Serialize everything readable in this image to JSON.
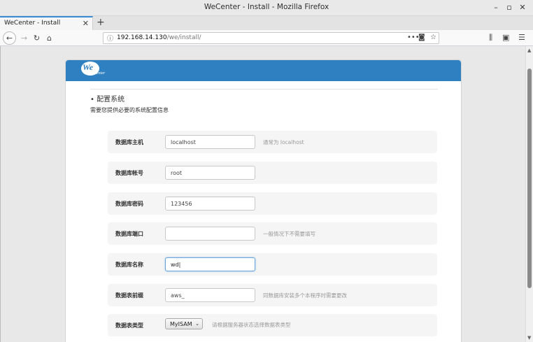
{
  "window": {
    "title": "WeCenter - Install - Mozilla Firefox"
  },
  "tab": {
    "label": "WeCenter - Install"
  },
  "url": {
    "host": "192.168.14.130",
    "path": "/we/install/"
  },
  "logo": {
    "we": "We",
    "center": "Center"
  },
  "section": {
    "title": "• 配置系统",
    "desc": "需要您提供必要的系统配置信息"
  },
  "fields": [
    {
      "label": "数据库主机",
      "value": "localhost",
      "hint": "通常为 localhost"
    },
    {
      "label": "数据库帐号",
      "value": "root",
      "hint": ""
    },
    {
      "label": "数据库密码",
      "value": "123456",
      "hint": ""
    },
    {
      "label": "数据库端口",
      "value": "",
      "hint": "一般情况下不需要填写"
    },
    {
      "label": "数据库名称",
      "value": "wd|",
      "hint": ""
    },
    {
      "label": "数据表前缀",
      "value": "aws_",
      "hint": "同数据库安装多个本程序时需要更改"
    }
  ],
  "engine": {
    "label": "数据表类型",
    "selected": "MyISAM",
    "hint": "请根据服务器状态选择数据表类型"
  },
  "colors": {
    "header": "#2f80c0",
    "tab_accent": "#3b8cd6"
  }
}
